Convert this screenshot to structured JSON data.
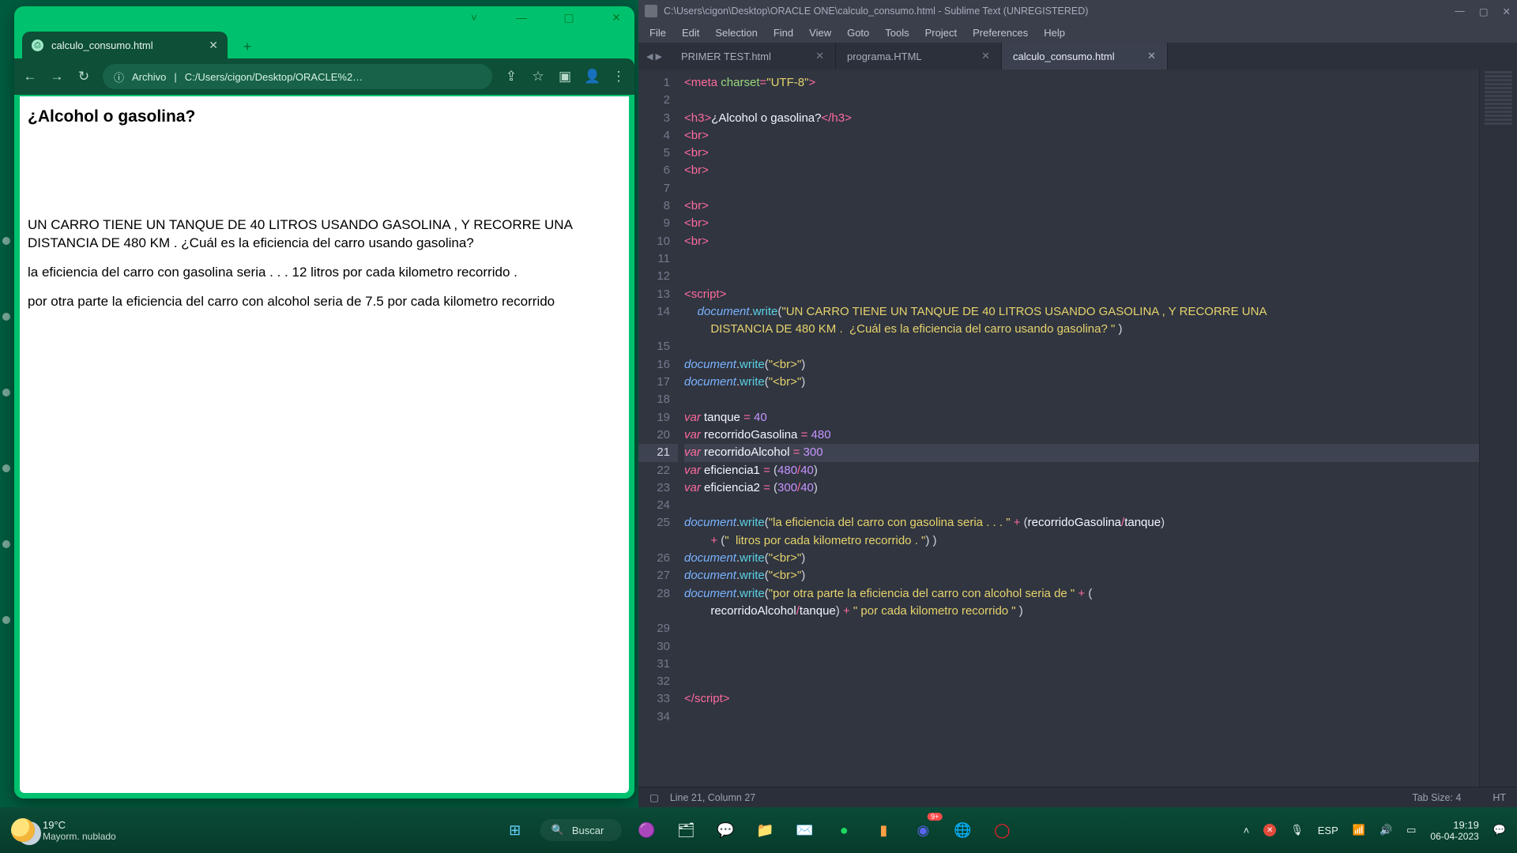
{
  "chrome": {
    "window_controls": {
      "min": "—",
      "max": "▢",
      "close": "✕"
    },
    "tab": {
      "title": "calculo_consumo.html",
      "close": "✕"
    },
    "new_tab": "+",
    "nav": {
      "back": "←",
      "forward": "→",
      "reload": "↻"
    },
    "omnibox": {
      "info": "ⓘ",
      "scheme": "Archivo",
      "sep": "|",
      "path": "C:/Users/cigon/Desktop/ORACLE%2…",
      "share": "⇪",
      "star": "☆",
      "panel": "▣",
      "profile": "👤",
      "kebab": "⋮"
    },
    "page": {
      "h3": "¿Alcohol o gasolina?",
      "p1": "UN CARRO TIENE UN TANQUE DE 40 LITROS USANDO GASOLINA , Y RECORRE UNA DISTANCIA DE 480 KM . ¿Cuál es la eficiencia del carro usando gasolina?",
      "p2": "la eficiencia del carro con gasolina seria . . . 12 litros por cada kilometro recorrido .",
      "p3": "por otra parte la eficiencia del carro con alcohol seria de 7.5 por cada kilometro recorrido"
    }
  },
  "sublime": {
    "title": "C:\\Users\\cigon\\Desktop\\ORACLE ONE\\calculo_consumo.html - Sublime Text (UNREGISTERED)",
    "menu": [
      "File",
      "Edit",
      "Selection",
      "Find",
      "View",
      "Goto",
      "Tools",
      "Project",
      "Preferences",
      "Help"
    ],
    "tabs": [
      {
        "label": "PRIMER TEST.html",
        "active": false
      },
      {
        "label": "programa.HTML",
        "active": false
      },
      {
        "label": "calculo_consumo.html",
        "active": true
      }
    ],
    "lines": 34,
    "highlight_line": 21,
    "status": {
      "left_box": "▢",
      "pos": "Line 21, Column 27",
      "tabsize": "Tab Size: 4",
      "syntax": "HT"
    },
    "code": {
      "l1": {
        "tag_open": "<",
        "tag": "meta",
        "sp": " ",
        "attr": "charset",
        "eq": "=",
        "str": "\"UTF-8\"",
        "tag_close": ">"
      },
      "l3": {
        "open": "<",
        "tag": "h3",
        "gt": ">",
        "text": "¿Alcohol o gasolina?",
        "close_open": "</",
        "close_gt": ">"
      },
      "br": {
        "open": "<",
        "tag": "br",
        "gt": ">"
      },
      "l13": {
        "open": "<",
        "tag": "script",
        "gt": ">"
      },
      "l14a": {
        "ind": "    ",
        "obj": "document",
        "dot": ".",
        "fn": "write",
        "lp": "(",
        "str": "\"UN CARRO TIENE UN TANQUE DE 40 LITROS USANDO GASOLINA , Y RECORRE UNA "
      },
      "l14b": {
        "ind": "        ",
        "str": "DISTANCIA DE 480 KM .  ¿Cuál es la eficiencia del carro usando gasolina? \"",
        "sp": " ",
        "rp": ")"
      },
      "l16": {
        "obj": "document",
        "dot": ".",
        "fn": "write",
        "lp": "(",
        "str": "\"<br>\"",
        "rp": ")"
      },
      "l19": {
        "kw": "var",
        "sp": " ",
        "id": "tanque",
        "sp2": " ",
        "op": "=",
        "sp3": " ",
        "num": "40"
      },
      "l20": {
        "kw": "var",
        "sp": " ",
        "id": "recorridoGasolina",
        "sp2": " ",
        "op": "=",
        "sp3": " ",
        "num": "480"
      },
      "l21": {
        "kw": "var",
        "sp": " ",
        "id": "recorridoAlcohol",
        "sp2": " ",
        "op": "=",
        "sp3": " ",
        "num": "300"
      },
      "l22": {
        "kw": "var",
        "sp": " ",
        "id": "eficiencia1",
        "sp2": " ",
        "op": "=",
        "sp3": " ",
        "lp": "(",
        "n1": "480",
        "sl": "/",
        "n2": "40",
        "rp": ")"
      },
      "l23": {
        "kw": "var",
        "sp": " ",
        "id": "eficiencia2",
        "sp2": " ",
        "op": "=",
        "sp3": " ",
        "lp": "(",
        "n1": "300",
        "sl": "/",
        "n2": "40",
        "rp": ")"
      },
      "l25a": {
        "obj": "document",
        "dot": ".",
        "fn": "write",
        "lp": "(",
        "str": "\"la eficiencia del carro con gasolina seria . . . \"",
        "sp": " ",
        "op": "+",
        "sp2": " ",
        "lp2": "(",
        "id1": "recorridoGasolina",
        "sl": "/",
        "id2": "tanque",
        "rp2": ")",
        "sp3": " "
      },
      "l25b": {
        "ind": "        ",
        "op": "+",
        "sp": " ",
        "lp": "(",
        "str": "\"  litros por cada kilometro recorrido . \"",
        "rp": ")",
        "sp2": " ",
        "rp2": ")"
      },
      "l28a": {
        "obj": "document",
        "dot": ".",
        "fn": "write",
        "lp": "(",
        "str": "\"por otra parte la eficiencia del carro con alcohol seria de \"",
        "sp": " ",
        "op": "+",
        "sp2": " ",
        "lp2": "("
      },
      "l28b": {
        "ind": "        ",
        "id1": "recorridoAlcohol",
        "sl": "/",
        "id2": "tanque",
        "rp": ")",
        "sp": " ",
        "op": "+",
        "sp2": " ",
        "str": "\" por cada kilometro recorrido \"",
        "sp3": " ",
        "rp2": ")"
      },
      "l33": {
        "open": "</",
        "tag": "script",
        "gt": ">"
      }
    }
  },
  "taskbar": {
    "weather": {
      "temp": "19°C",
      "desc": "Mayorm. nublado"
    },
    "search_placeholder": "Buscar",
    "tray": {
      "chevron": "˄",
      "shield": "✕",
      "mic": "🎙",
      "lang": "ESP",
      "wifi": "📶",
      "vol": "🔊",
      "bat": "▭",
      "time": "19:19",
      "date": "06-04-2023",
      "notif": "💬"
    }
  }
}
